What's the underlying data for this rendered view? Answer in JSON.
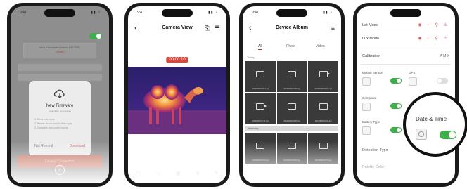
{
  "phone1": {
    "time": "9:47",
    "info_line": "New Firmware Version (NV.X89)",
    "info_action": "Details",
    "dialog": {
      "title": "New Firmware",
      "subtitle": "AMOPS-1000000",
      "notes": [
        "1. Read note more",
        "2. Please do not switch other apps",
        "3. Complete and power supply"
      ],
      "cancel_label": "Not Remind",
      "confirm_label": "Download"
    },
    "bottom_button_label": "Device Connection"
  },
  "phone2": {
    "time": "9:47",
    "title": "Camera View",
    "rec_timer": "00:00:10"
  },
  "phone3": {
    "time": "9:47",
    "title": "Device Album",
    "tabs": [
      "All",
      "Photo",
      "Video"
    ],
    "section1": "Today",
    "section2": "Yesterday",
    "files_row1": [
      "20230506070714.jpg",
      "20230506070725.jpg",
      "20230506073011.mp4"
    ],
    "files_row2": [
      "20230506070714.mp4",
      "20230506073025.jpg",
      "20230506070725.jpg"
    ],
    "files_row3": [
      "20230506070714.jpg",
      "20230506073025.jpg",
      "20230506070725.jpg"
    ]
  },
  "phone4": {
    "row1_label": "Lat Mode",
    "row2_label": "Lux Mode",
    "calibration_label": "Calibration",
    "calibration_options": "A  M  X",
    "cards": [
      "Motion Sensor",
      "GPS",
      "Compass",
      "Battery Type",
      "Detection Type",
      "Palette Color"
    ],
    "zoom_title": "Date & Time"
  },
  "colors": {
    "accent_green": "#3fae4a",
    "record_red": "#e0453a",
    "brand_red": "#c97968"
  }
}
